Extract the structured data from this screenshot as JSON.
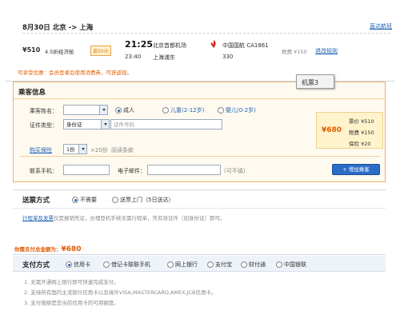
{
  "flight": {
    "date_route": "8月30日 北京 -> 上海",
    "rules_link": "直达航班",
    "price": "¥510",
    "discount": "4.5折经济舱",
    "badge": "返50元",
    "dep_time": "21:25",
    "dep_airport": "北京首都机场",
    "arr_time": "23:40",
    "arr_airport": "上海浦东",
    "airline": "中国国航 CA1861",
    "aircraft": "330",
    "tax": "税费 ¥150",
    "refund_link": "退改规则"
  },
  "notice": {
    "text": "可享受优惠：会员登录后使用消费券，可获返现。"
  },
  "passenger": {
    "section_title": "乘客信息",
    "tooltip": "机票3",
    "name_label": "乘客姓名：",
    "name_value": "",
    "type_options": [
      "成人",
      "儿童(2-12岁)",
      "婴儿(0-2岁)"
    ],
    "id_label": "证件类型：",
    "id_type": "身份证",
    "id_placeholder": "证件号码",
    "insurance_link": "购买保险",
    "insurance_count": "1份",
    "insurance_price": "×20份",
    "insurance_terms": "阅读条款",
    "price_total": "¥680",
    "price_lines": [
      "票价 ¥510",
      "税费 ¥150",
      "保险 ¥20"
    ],
    "phone_label": "联系手机：",
    "email_label": "电子邮件：",
    "email_hint": "(可不填)",
    "add_button": "+ 增加乘客"
  },
  "delivery": {
    "title": "送票方式",
    "options": [
      "不需要",
      "送票上门（5日送达）"
    ],
    "info_link": "行程单及发票",
    "info_text": "仅是报销凭证，办理登机手续无需行程单，凭有效证件（如身份证）即可。"
  },
  "payment_total": {
    "label": "你需支付总金额为：",
    "amount": "¥680"
  },
  "payment": {
    "title": "支付方式",
    "options": [
      "信用卡",
      "借记卡联联手机",
      "网上银行",
      "支付宝",
      "财付通",
      "中国银联"
    ],
    "notes": [
      "1. 无需开通网上银行即可快速完成支付。",
      "2. 支持所有国内主流银行信用卡以及境外VISA,MASTERCARD,AMEX,JCB信用卡。",
      "3. 支付限额是您当前信用卡的可用额度。"
    ]
  },
  "colors": {
    "accent": "#1a5fb4",
    "orange": "#e35b00",
    "section_bg": "#fffaf0",
    "price_box": "#fff6d8",
    "header_bg": "#eef3fa"
  }
}
